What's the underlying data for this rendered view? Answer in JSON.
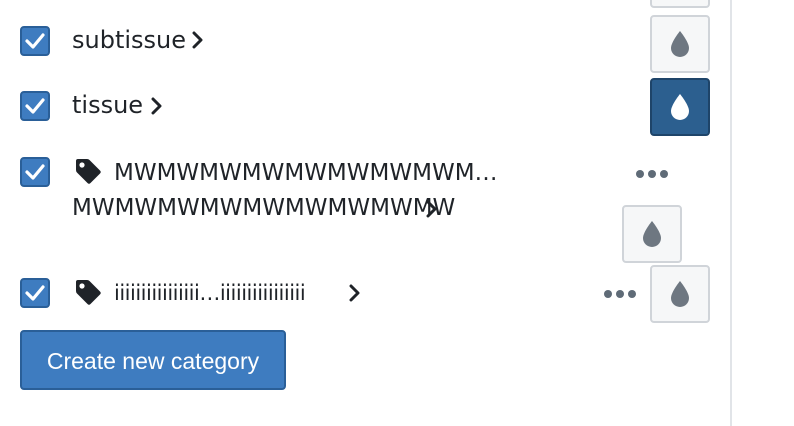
{
  "categories": [
    {
      "label": "subtissue",
      "checked": true,
      "tagged": false,
      "color_active": false
    },
    {
      "label": "tissue",
      "checked": true,
      "tagged": false,
      "color_active": true
    },
    {
      "label_line1": "MWMWMWMWMWMWMWMWM…",
      "label_line2": "MWMWMWMWMWMWMWMWMW",
      "checked": true,
      "tagged": true,
      "color_active": false
    },
    {
      "label": "iiiiiiiiiiiiiiii…iiiiiiiiiiiiiiii",
      "checked": true,
      "tagged": true,
      "color_active": false
    }
  ],
  "create_button_label": "Create new category",
  "icons": {
    "check": "check-icon",
    "chevron": "chevron-right-icon",
    "tag": "tag-icon",
    "color": "droplet-icon",
    "more": "more-horizontal-icon"
  },
  "colors": {
    "accent": "#3e7cc0",
    "accent_border": "#2a5f98",
    "active_swatch": "#2c5f8f",
    "droplet": "#6e7781",
    "droplet_active": "#ffffff",
    "text": "#1f2328"
  }
}
